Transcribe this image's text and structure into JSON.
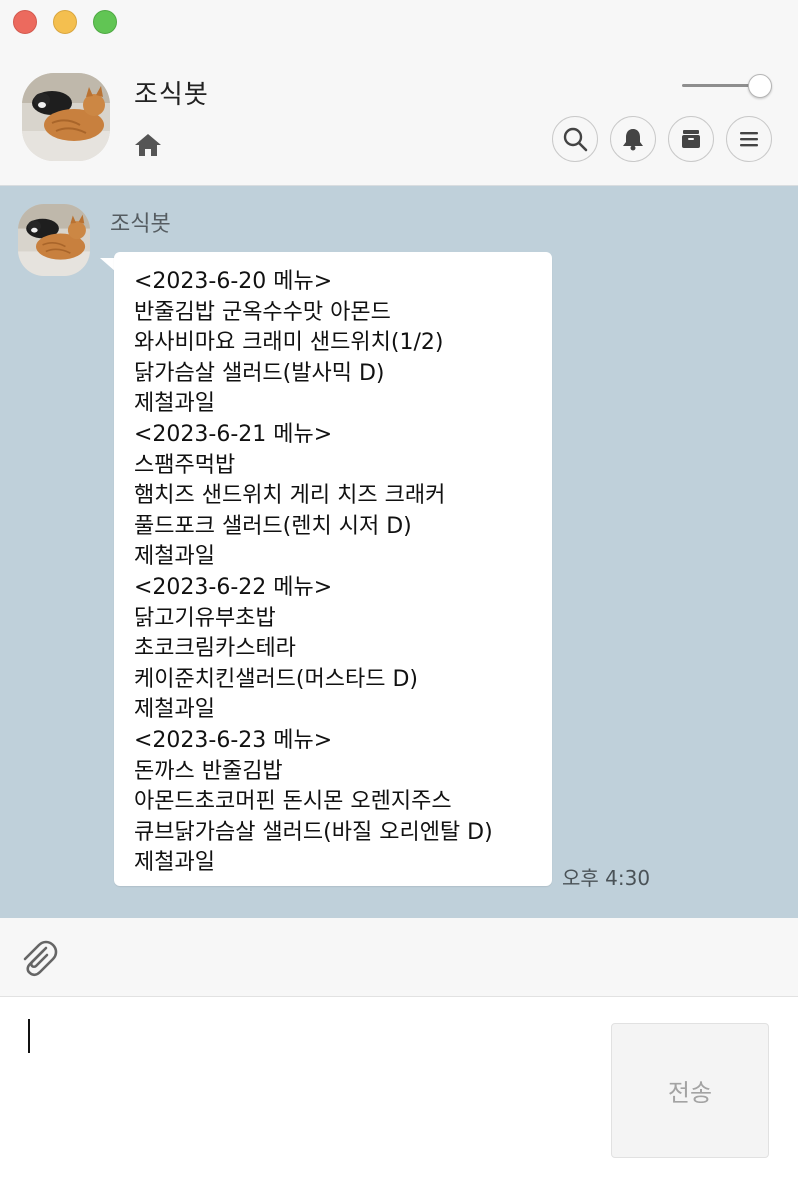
{
  "window": {
    "controls": [
      "close",
      "minimize",
      "maximize"
    ]
  },
  "header": {
    "title": "조식봇",
    "home_icon": "home-icon",
    "actions": [
      "search-icon",
      "bell-icon",
      "drawer-icon",
      "menu-icon"
    ],
    "opacity_slider_value": 1.0
  },
  "chat": {
    "background_color": "#bfd0da",
    "messages": [
      {
        "sender": "조식봇",
        "time": "오후 4:30",
        "lines": [
          "<2023-6-20 메뉴>",
          "반줄김밥 군옥수수맛 아몬드",
          "와사비마요 크래미 샌드위치(1/2)",
          "닭가슴살 샐러드(발사믹 D)",
          "제철과일",
          "<2023-6-21 메뉴>",
          "스팸주먹밥",
          "햄치즈 샌드위치 게리 치즈 크래커",
          "풀드포크 샐러드(렌치 시저 D)",
          "제철과일",
          "<2023-6-22 메뉴>",
          "닭고기유부초밥",
          "초코크림카스테라",
          "케이준치킨샐러드(머스타드 D)",
          "제철과일",
          "<2023-6-23 메뉴>",
          "돈까스 반줄김밥",
          "아몬드초코머핀 돈시몬 오렌지주스",
          "큐브닭가슴살 샐러드(바질 오리엔탈 D)",
          "제철과일"
        ]
      }
    ]
  },
  "composer": {
    "attach_icon": "paperclip-icon",
    "input_value": "",
    "send_label": "전송"
  }
}
